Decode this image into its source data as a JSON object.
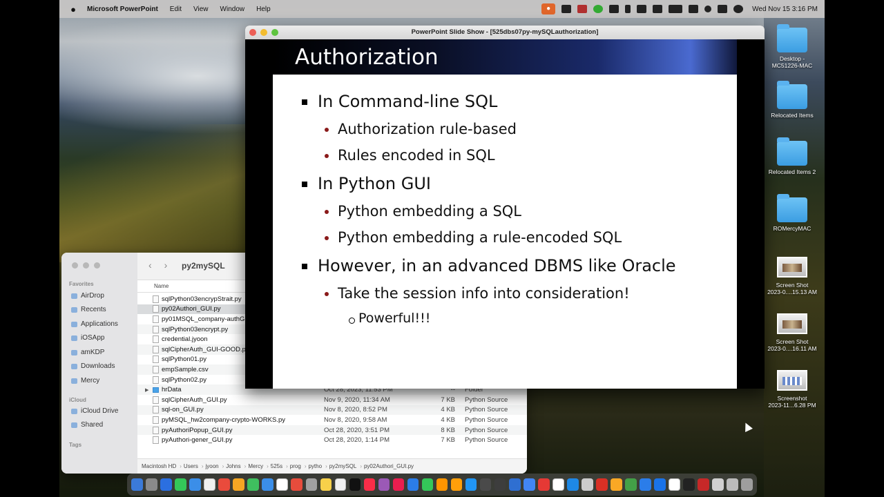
{
  "menubar": {
    "app_name": "Microsoft PowerPoint",
    "menus": [
      "Edit",
      "View",
      "Window",
      "Help"
    ],
    "clock": "Wed Nov 15  3:16 PM"
  },
  "slideshow": {
    "window_title": "PowerPoint Slide Show - [525dbs07py-mySQLauthorization]",
    "slide": {
      "title": "Authorization",
      "bullets": [
        {
          "level": 1,
          "text": "In Command-line SQL"
        },
        {
          "level": 2,
          "text": "Authorization rule-based"
        },
        {
          "level": 2,
          "text": "Rules encoded in SQL"
        },
        {
          "level": 1,
          "text": "In Python GUI"
        },
        {
          "level": 2,
          "text": "Python embedding a SQL"
        },
        {
          "level": 2,
          "text": "Python embedding a rule-encoded SQL"
        },
        {
          "level": 1,
          "text": "However, in an advanced DBMS like Oracle"
        },
        {
          "level": 2,
          "text": "Take the session info into consideration!"
        },
        {
          "level": 3,
          "text": "Powerful!!!"
        }
      ]
    }
  },
  "finder": {
    "folder_title": "py2mySQL",
    "sidebar": {
      "favorites_label": "Favorites",
      "favorites": [
        "AirDrop",
        "Recents",
        "Applications",
        "iOSApp",
        "amKDP",
        "Downloads",
        "Mercy"
      ],
      "icloud_label": "iCloud",
      "icloud": [
        "iCloud Drive",
        "Shared"
      ],
      "tags_label": "Tags"
    },
    "column_name": "Name",
    "files": [
      {
        "name": "sqlPython03encrypStrait.py",
        "date": "",
        "size": "",
        "kind": ""
      },
      {
        "name": "py02Authori_GUI.py",
        "date": "",
        "size": "",
        "kind": ""
      },
      {
        "name": "py01MSQL_company-authG",
        "date": "",
        "size": "",
        "kind": ""
      },
      {
        "name": "sqlPython03encrypt.py",
        "date": "",
        "size": "",
        "kind": ""
      },
      {
        "name": "credential.jyoon",
        "date": "",
        "size": "",
        "kind": ""
      },
      {
        "name": "sqlCipherAuth_GUI-GOOD.p",
        "date": "",
        "size": "",
        "kind": ""
      },
      {
        "name": "sqlPython01.py",
        "date": "",
        "size": "",
        "kind": ""
      },
      {
        "name": "empSample.csv",
        "date": "",
        "size": "",
        "kind": ""
      },
      {
        "name": "sqlPython02.py",
        "date": "",
        "size": "",
        "kind": ""
      },
      {
        "name": "hrData",
        "date": "Oct 28, 2023, 11:53 PM",
        "size": "--",
        "kind": "Folder",
        "folder": true
      },
      {
        "name": "sqlCipherAuth_GUI.py",
        "date": "Nov 9, 2020, 11:34 AM",
        "size": "7 KB",
        "kind": "Python Source"
      },
      {
        "name": "sql-on_GUI.py",
        "date": "Nov 8, 2020, 8:52 PM",
        "size": "4 KB",
        "kind": "Python Source"
      },
      {
        "name": "pyMSQL_hw2company-crypto-WORKS.py",
        "date": "Nov 8, 2020, 9:58 AM",
        "size": "4 KB",
        "kind": "Python Source"
      },
      {
        "name": "pyAuthoriPopup_GUI.py",
        "date": "Oct 28, 2020, 3:51 PM",
        "size": "8 KB",
        "kind": "Python Source"
      },
      {
        "name": "pyAuthori-gener_GUI.py",
        "date": "Oct 28, 2020, 1:14 PM",
        "size": "7 KB",
        "kind": "Python Source"
      }
    ],
    "pathbar": [
      "Macintosh HD",
      "Users",
      "jyoon",
      "Johns",
      "Mercy",
      "525s",
      "prog",
      "pytho",
      "py2mySQL",
      "py02Authori_GUI.py"
    ]
  },
  "desktop_icons": [
    {
      "label": "Desktop -\nMC51226-MAC",
      "icon": "folder-icon"
    },
    {
      "label": "Relocated Items",
      "icon": "folder-icon"
    },
    {
      "label": "Relocated Items 2",
      "icon": "folder-icon"
    },
    {
      "label": "ROMercyMAC",
      "icon": "folder-icon"
    },
    {
      "label": "Screen Shot\n2023-0....15.13 AM",
      "icon": "screenshot-icon"
    },
    {
      "label": "Screen Shot\n2023-0....16.11 AM",
      "icon": "screenshot-icon"
    },
    {
      "label": "Screenshot\n2023-11...6.28 PM",
      "icon": "screenshot-icon"
    }
  ],
  "dock": {
    "colors": [
      "#3b7ad8",
      "#8a8a8a",
      "#2b6fe0",
      "#34c759",
      "#3b8ee8",
      "#f0f0f0",
      "#e94b3c",
      "#f5a623",
      "#3fbf5f",
      "#3b8ee8",
      "#ffffff",
      "#e74c3c",
      "#a0a0a0",
      "#f7d04a",
      "#f0f0f0",
      "#111111",
      "#fa2d48",
      "#9b59b6",
      "#e91e4f",
      "#2b7de9",
      "#34c759",
      "#ff9500",
      "#ff9f0a",
      "#2196f3",
      "#4a4a4a",
      "#3d3d3d",
      "#2f6fd1",
      "#4285f4",
      "#e53935",
      "#ffffff",
      "#1e88e5",
      "#cccccc",
      "#d93025",
      "#f9a825",
      "#43a047",
      "#2b7de9",
      "#1a73e8",
      "#ffffff",
      "#222222",
      "#c62828",
      "#d0d0d0",
      "#bbbbbb",
      "#9e9e9e"
    ]
  }
}
